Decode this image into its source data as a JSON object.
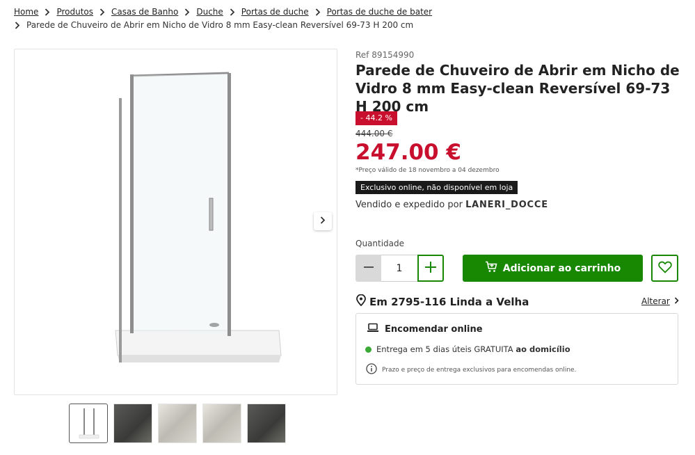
{
  "breadcrumb": {
    "items": [
      "Home",
      "Produtos",
      "Casas de Banho",
      "Duche",
      "Portas de duche",
      "Portas de duche de bater"
    ],
    "current": "Parede de Chuveiro de Abrir em Nicho de Vidro 8 mm Easy-clean Reversível 69-73 H 200 cm"
  },
  "product": {
    "ref": "Ref 89154990",
    "title": "Parede de Chuveiro de Abrir em Nicho de Vidro 8 mm Easy-clean Reversível 69-73 H 200 cm",
    "discount": "- 44.2 %",
    "old_price": "444.00 €",
    "price": "247.00 €",
    "price_validity": "*Preço válido de 18 novembro a 04 dezembro",
    "online_badge": "Exclusivo online, não disponível em loja",
    "seller_prefix": "Vendido e expedido por",
    "seller_name": "LANERI_DOCCE"
  },
  "quantity": {
    "label": "Quantidade",
    "value": "1"
  },
  "actions": {
    "add_to_cart": "Adicionar ao carrinho"
  },
  "store": {
    "location": "Em 2795-116 Linda a Velha",
    "change_label": "Alterar"
  },
  "delivery": {
    "title": "Encomendar online",
    "line_prefix": "Entrega em 5 dias úteis GRATUITA",
    "line_suffix": "ao domicílio",
    "info": "Prazo e preço de entrega exclusivos para encomendas online."
  },
  "colors": {
    "accent_green": "#188803",
    "price_red": "#c8102e",
    "status_green": "#3aa935"
  },
  "gallery": {
    "thumbnail_count": 5,
    "active_thumbnail": 1
  }
}
